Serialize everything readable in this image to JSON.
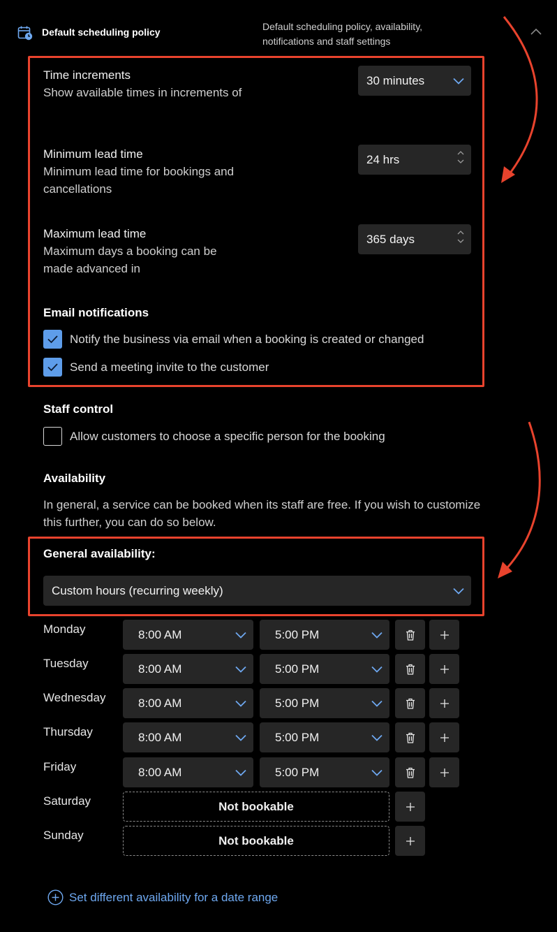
{
  "header": {
    "title": "Default scheduling policy",
    "description": "Default scheduling policy, availability, notifications and staff settings",
    "icon": "calendar-clock-icon"
  },
  "time_increments": {
    "label": "Time increments",
    "description": "Show available times in increments of",
    "value": "30 minutes"
  },
  "min_lead": {
    "label": "Minimum lead time",
    "description": "Minimum lead time for bookings and cancellations",
    "value": "24 hrs"
  },
  "max_lead": {
    "label": "Maximum lead time",
    "description": "Maximum days a booking can be made advanced in",
    "value": "365 days"
  },
  "email": {
    "title": "Email notifications",
    "notify_business": {
      "label": "Notify the business via email when a booking is created or changed",
      "checked": true
    },
    "send_invite": {
      "label": "Send a meeting invite to the customer",
      "checked": true
    }
  },
  "staff": {
    "title": "Staff control",
    "allow_choose": {
      "label": "Allow customers to choose a specific person for the booking",
      "checked": false
    }
  },
  "availability": {
    "title": "Availability",
    "description": "In general, a service can be booked when its staff are free. If you wish to customize this further, you can do so below.",
    "general_label": "General availability:",
    "general_value": "Custom hours (recurring weekly)"
  },
  "days": [
    {
      "name": "Monday",
      "start": "8:00 AM",
      "end": "5:00 PM"
    },
    {
      "name": "Tuesday",
      "start": "8:00 AM",
      "end": "5:00 PM"
    },
    {
      "name": "Wednesday",
      "start": "8:00 AM",
      "end": "5:00 PM"
    },
    {
      "name": "Thursday",
      "start": "8:00 AM",
      "end": "5:00 PM"
    },
    {
      "name": "Friday",
      "start": "8:00 AM",
      "end": "5:00 PM"
    },
    {
      "name": "Saturday",
      "status": "Not bookable"
    },
    {
      "name": "Sunday",
      "status": "Not bookable"
    }
  ],
  "date_range_link": "Set different availability for a date range",
  "colors": {
    "accent": "#5e9dea",
    "link": "#6ea8f0",
    "highlight": "#e8432d",
    "field": "#262626"
  }
}
